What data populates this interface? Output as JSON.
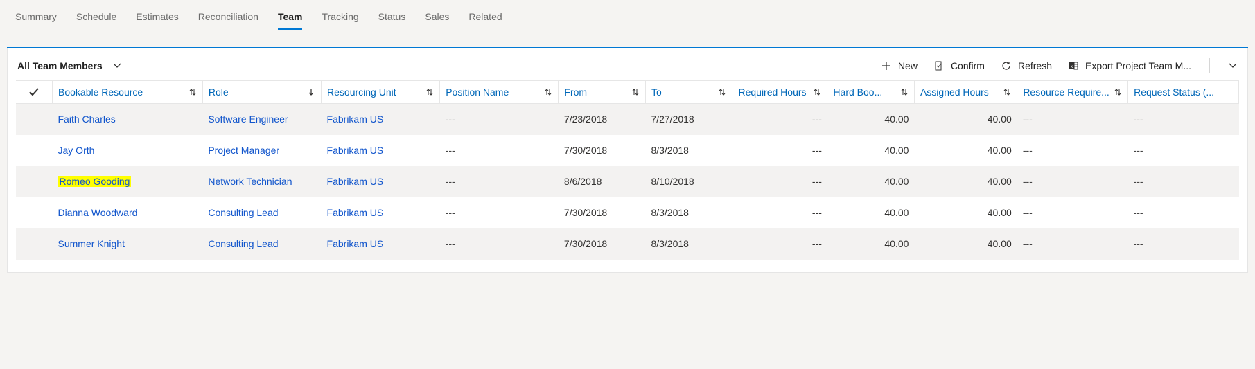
{
  "tabs": {
    "items": [
      "Summary",
      "Schedule",
      "Estimates",
      "Reconciliation",
      "Team",
      "Tracking",
      "Status",
      "Sales",
      "Related"
    ],
    "active_index": 4
  },
  "view": {
    "title": "All Team Members"
  },
  "commands": {
    "new": "New",
    "confirm": "Confirm",
    "refresh": "Refresh",
    "export": "Export Project Team M..."
  },
  "columns": [
    {
      "label": "Bookable Resource",
      "sort": "both"
    },
    {
      "label": "Role",
      "sort": "down"
    },
    {
      "label": "Resourcing Unit",
      "sort": "both"
    },
    {
      "label": "Position Name",
      "sort": "both"
    },
    {
      "label": "From",
      "sort": "both"
    },
    {
      "label": "To",
      "sort": "both"
    },
    {
      "label": "Required Hours",
      "sort": "both"
    },
    {
      "label": "Hard Boo...",
      "sort": "both"
    },
    {
      "label": "Assigned Hours",
      "sort": "both"
    },
    {
      "label": "Resource Require...",
      "sort": "both"
    },
    {
      "label": "Request Status (...",
      "sort": ""
    }
  ],
  "rows": [
    {
      "resource": "Faith Charles",
      "role": "Software Engineer",
      "unit": "Fabrikam US",
      "position": "---",
      "from": "7/23/2018",
      "to": "7/27/2018",
      "required": "---",
      "hard": "40.00",
      "assigned": "40.00",
      "reqres": "---",
      "status": "---",
      "highlight": false
    },
    {
      "resource": "Jay Orth",
      "role": "Project Manager",
      "unit": "Fabrikam US",
      "position": "---",
      "from": "7/30/2018",
      "to": "8/3/2018",
      "required": "---",
      "hard": "40.00",
      "assigned": "40.00",
      "reqres": "---",
      "status": "---",
      "highlight": false
    },
    {
      "resource": "Romeo Gooding",
      "role": "Network Technician",
      "unit": "Fabrikam US",
      "position": "---",
      "from": "8/6/2018",
      "to": "8/10/2018",
      "required": "---",
      "hard": "40.00",
      "assigned": "40.00",
      "reqres": "---",
      "status": "---",
      "highlight": true
    },
    {
      "resource": "Dianna Woodward",
      "role": "Consulting Lead",
      "unit": "Fabrikam US",
      "position": "---",
      "from": "7/30/2018",
      "to": "8/3/2018",
      "required": "---",
      "hard": "40.00",
      "assigned": "40.00",
      "reqres": "---",
      "status": "---",
      "highlight": false
    },
    {
      "resource": "Summer Knight",
      "role": "Consulting Lead",
      "unit": "Fabrikam US",
      "position": "---",
      "from": "7/30/2018",
      "to": "8/3/2018",
      "required": "---",
      "hard": "40.00",
      "assigned": "40.00",
      "reqres": "---",
      "status": "---",
      "highlight": false
    }
  ]
}
